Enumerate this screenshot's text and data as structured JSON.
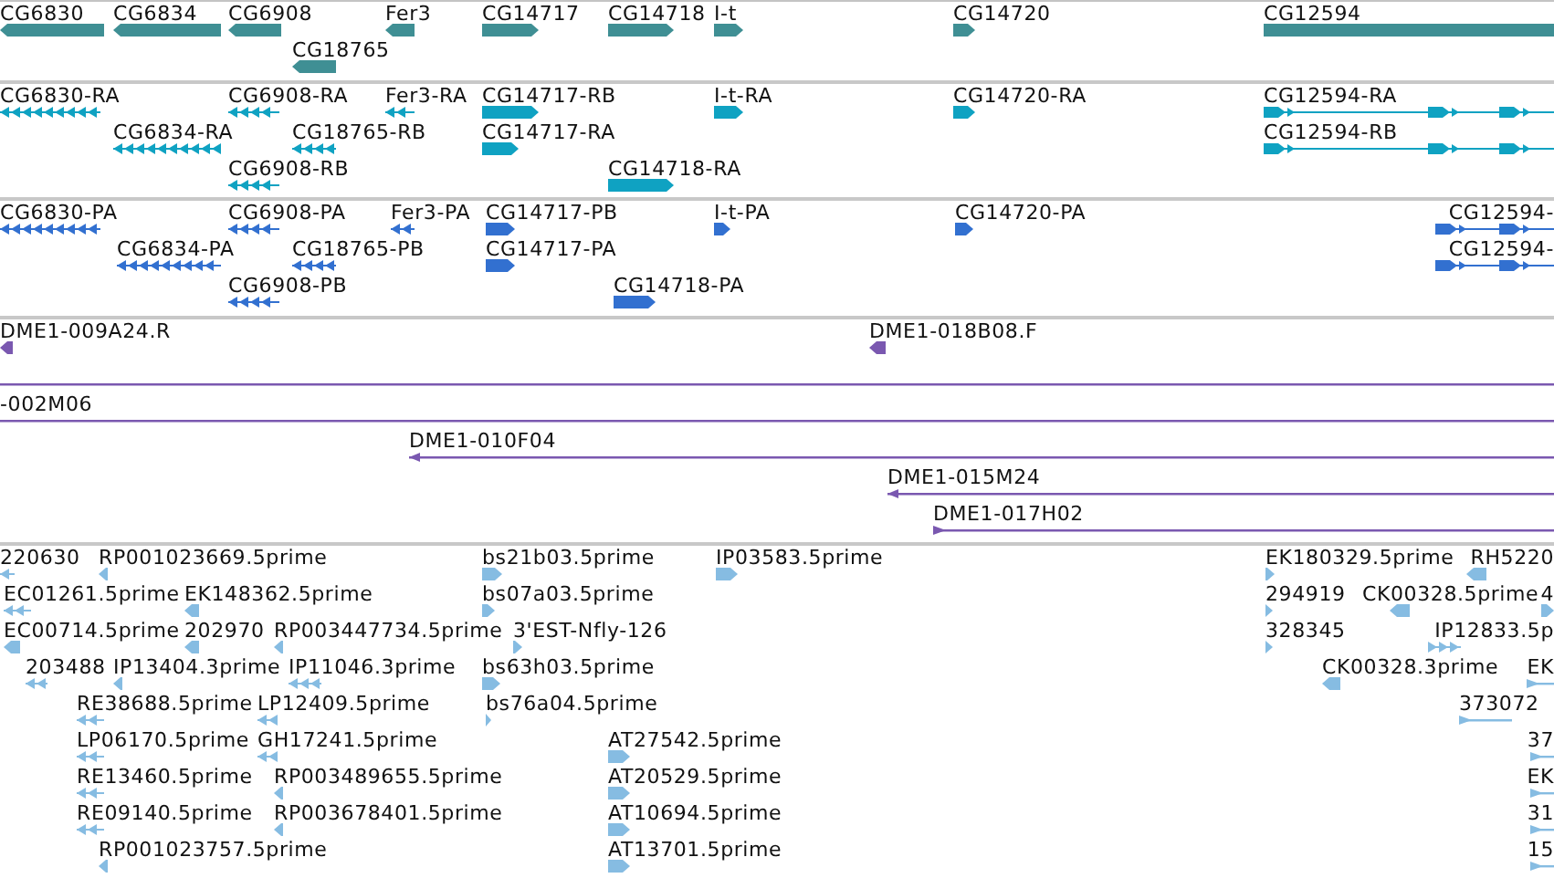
{
  "tracks": [
    {
      "kind": "gene",
      "features": [
        {
          "label": "CG6830",
          "reverse": true
        },
        {
          "label": "CG6834",
          "reverse": true
        },
        {
          "label": "CG6908",
          "reverse": true
        },
        {
          "label": "Fer3",
          "reverse": true
        },
        {
          "label": "CG14717",
          "reverse": false
        },
        {
          "label": "CG14718",
          "reverse": false
        },
        {
          "label": "I-t",
          "reverse": false
        },
        {
          "label": "CG14720",
          "reverse": false
        },
        {
          "label": "CG12594",
          "reverse": false
        },
        {
          "label": "CG18765",
          "reverse": true
        }
      ]
    },
    {
      "kind": "transcript",
      "features": [
        {
          "label": "CG6830-RA",
          "reverse": true
        },
        {
          "label": "CG6908-RA",
          "reverse": true
        },
        {
          "label": "Fer3-RA",
          "reverse": true
        },
        {
          "label": "CG14717-RB",
          "reverse": false
        },
        {
          "label": "I-t-RA",
          "reverse": false
        },
        {
          "label": "CG14720-RA",
          "reverse": false
        },
        {
          "label": "CG12594-RA",
          "reverse": false
        },
        {
          "label": "CG6834-RA",
          "reverse": true
        },
        {
          "label": "CG18765-RB",
          "reverse": true
        },
        {
          "label": "CG14717-RA",
          "reverse": false
        },
        {
          "label": "CG12594-RB",
          "reverse": false
        },
        {
          "label": "CG6908-RB",
          "reverse": true
        },
        {
          "label": "CG14718-RA",
          "reverse": false
        }
      ]
    },
    {
      "kind": "protein",
      "features": [
        {
          "label": "CG6830-PA",
          "reverse": true
        },
        {
          "label": "CG6908-PA",
          "reverse": true
        },
        {
          "label": "Fer3-PA",
          "reverse": true
        },
        {
          "label": "CG14717-PB",
          "reverse": false
        },
        {
          "label": "I-t-PA",
          "reverse": false
        },
        {
          "label": "CG14720-PA",
          "reverse": false
        },
        {
          "label": "CG12594-",
          "reverse": false
        },
        {
          "label": "CG6834-PA",
          "reverse": true
        },
        {
          "label": "CG18765-PB",
          "reverse": true
        },
        {
          "label": "CG14717-PA",
          "reverse": false
        },
        {
          "label": "CG12594-",
          "reverse": false
        },
        {
          "label": "CG6908-PB",
          "reverse": true
        },
        {
          "label": "CG14718-PA",
          "reverse": false
        }
      ]
    },
    {
      "kind": "clone",
      "features": [
        {
          "label": "DME1-009A24.R",
          "arrowhead": true,
          "reverse": true
        },
        {
          "label": "DME1-018B08.F",
          "arrowhead": true,
          "reverse": true
        },
        {
          "arrowhead": false
        },
        {
          "label": "-002M06",
          "arrowhead": false
        },
        {
          "label": "DME1-010F04",
          "arrowhead": true,
          "reverse": true
        },
        {
          "label": "DME1-015M24",
          "arrowhead": true,
          "reverse": true
        },
        {
          "label": "DME1-017H02",
          "arrowhead": true,
          "reverse": false
        }
      ]
    },
    {
      "kind": "est",
      "features": [
        {
          "label": "220630",
          "reverse": true
        },
        {
          "label": "RP001023669.5prime",
          "reverse": true
        },
        {
          "label": "bs21b03.5prime",
          "reverse": false
        },
        {
          "label": "IP03583.5prime",
          "reverse": false
        },
        {
          "label": "EK180329.5prime",
          "reverse": false
        },
        {
          "label": "RH5220",
          "reverse": true
        },
        {
          "label": "EC01261.5prime",
          "reverse": true
        },
        {
          "label": "EK148362.5prime",
          "reverse": true
        },
        {
          "label": "bs07a03.5prime",
          "reverse": false
        },
        {
          "label": "294919",
          "reverse": false
        },
        {
          "label": "CK00328.5prime",
          "reverse": true
        },
        {
          "label": "4",
          "reverse": false
        },
        {
          "label": "EC00714.5prime",
          "reverse": true
        },
        {
          "label": "202970",
          "reverse": true
        },
        {
          "label": "RP003447734.5prime",
          "reverse": true
        },
        {
          "label": "3'EST-Nfly-126",
          "reverse": false
        },
        {
          "label": "328345",
          "reverse": false
        },
        {
          "label": "IP12833.5p",
          "reverse": false
        },
        {
          "label": "203488",
          "reverse": true
        },
        {
          "label": "IP13404.3prime",
          "reverse": true
        },
        {
          "label": "IP11046.3prime",
          "reverse": true
        },
        {
          "label": "bs63h03.5prime",
          "reverse": false
        },
        {
          "label": "CK00328.3prime",
          "reverse": true
        },
        {
          "label": "EK",
          "reverse": false
        },
        {
          "label": "RE38688.5prime",
          "reverse": true
        },
        {
          "label": "LP12409.5prime",
          "reverse": true
        },
        {
          "label": "bs76a04.5prime",
          "reverse": false
        },
        {
          "label": "373072",
          "reverse": false
        },
        {
          "label": "LP06170.5prime",
          "reverse": true
        },
        {
          "label": "GH17241.5prime",
          "reverse": true
        },
        {
          "label": "AT27542.5prime",
          "reverse": false
        },
        {
          "label": "37",
          "reverse": false
        },
        {
          "label": "RE13460.5prime",
          "reverse": true
        },
        {
          "label": "RP003489655.5prime",
          "reverse": true
        },
        {
          "label": "AT20529.5prime",
          "reverse": false
        },
        {
          "label": "EK",
          "reverse": false
        },
        {
          "label": "RE09140.5prime",
          "reverse": true
        },
        {
          "label": "RP003678401.5prime",
          "reverse": true
        },
        {
          "label": "AT10694.5prime",
          "reverse": false
        },
        {
          "label": "31",
          "reverse": false
        },
        {
          "label": "RP001023757.5prime",
          "reverse": true
        },
        {
          "label": "AT13701.5prime",
          "reverse": false
        },
        {
          "label": "15",
          "reverse": false
        }
      ]
    }
  ]
}
